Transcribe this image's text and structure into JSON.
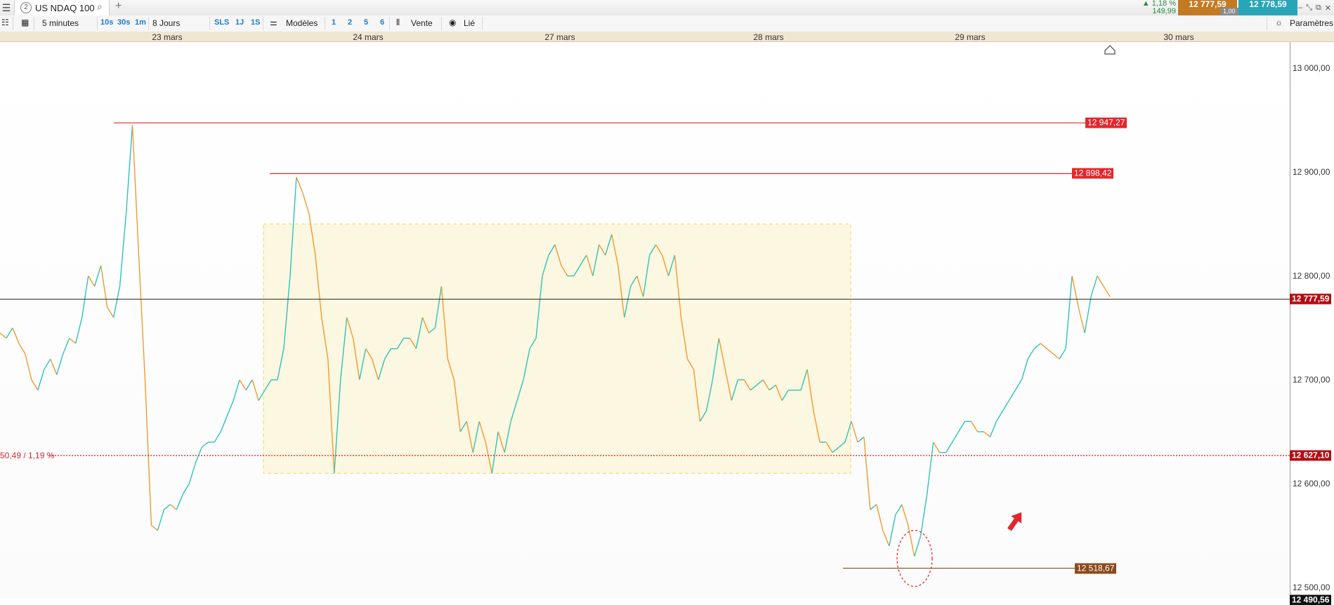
{
  "window": {
    "tab_number": "2",
    "tab_title": "US NDAQ 100",
    "add_tab_label": "+",
    "change_pct": "▲ 1,18 %",
    "change_abs": "149,99",
    "sell_price": "12 777,59",
    "buy_price": "12 778,59",
    "spread": "1,00",
    "settings_label": "Paramètres"
  },
  "toolbar": {
    "interval": "5 minutes",
    "quick_intervals": [
      "10s",
      "30s",
      "1m"
    ],
    "period": "8 Jours",
    "ranges": [
      "SLS",
      "1J",
      "1S"
    ],
    "templates_label": "Modèles",
    "template_slots": [
      "1",
      "2",
      "5",
      "6"
    ],
    "side_label": "Vente",
    "linked_label": "Lié"
  },
  "colors": {
    "up": "#2ec4b6",
    "down": "#f29a2e",
    "resistance": "#e3262c",
    "support": "#8b4a1c",
    "zone_fill": "#fbf6dc",
    "zone_border": "#f3d36a",
    "current_price_line": "#222222"
  },
  "chart_data": {
    "type": "line",
    "instrument": "US NDAQ 100",
    "timeframe": "5 minutes",
    "x_labels": [
      "23 mars",
      "24 mars",
      "27 mars",
      "28 mars",
      "29 mars",
      "30 mars"
    ],
    "ylim": [
      12490,
      13025
    ],
    "y_ticks": [
      "13 000,00",
      "12 900,00",
      "12 800,00",
      "12 700,00",
      "12 600,00",
      "12 500,00"
    ],
    "y_tick_values": [
      13000,
      12900,
      12800,
      12700,
      12600,
      12500
    ],
    "series": [
      {
        "values": [
          12745,
          12740,
          12750,
          12735,
          12725,
          12700,
          12690,
          12710,
          12720,
          12705,
          12725,
          12740,
          12735,
          12760,
          12800,
          12790,
          12810,
          12770,
          12760,
          12790,
          12860,
          12945,
          12820,
          12700,
          12560,
          12555,
          12575,
          12580,
          12575,
          12590,
          12600,
          12620,
          12635,
          12640,
          12640,
          12650,
          12665,
          12680,
          12700,
          12690,
          12700,
          12680,
          12690,
          12700,
          12700,
          12730,
          12800,
          12895,
          12880,
          12860,
          12820,
          12760,
          12720,
          12610,
          12700,
          12760,
          12740,
          12700,
          12730,
          12720,
          12700,
          12720,
          12730,
          12730,
          12740,
          12740,
          12730,
          12760,
          12745,
          12750,
          12790,
          12720,
          12700,
          12650,
          12660,
          12630,
          12660,
          12640,
          12610,
          12650,
          12630,
          12660,
          12680,
          12700,
          12730,
          12740,
          12800,
          12820,
          12830,
          12810,
          12800,
          12800,
          12810,
          12820,
          12800,
          12830,
          12820,
          12840,
          12810,
          12760,
          12790,
          12800,
          12780,
          12820,
          12830,
          12820,
          12800,
          12820,
          12760,
          12720,
          12710,
          12660,
          12670,
          12700,
          12740,
          12710,
          12680,
          12700,
          12700,
          12690,
          12695,
          12700,
          12690,
          12695,
          12680,
          12690,
          12690,
          12690,
          12710,
          12670,
          12640,
          12640,
          12630,
          12635,
          12640,
          12660,
          12640,
          12645,
          12575,
          12580,
          12555,
          12540,
          12570,
          12580,
          12560,
          12530,
          12550,
          12590,
          12640,
          12630,
          12630,
          12640,
          12650,
          12660,
          12660,
          12650,
          12650,
          12645,
          12660,
          12670,
          12680,
          12690,
          12700,
          12720,
          12730,
          12735,
          12730,
          12725,
          12720,
          12730,
          12800,
          12770,
          12745,
          12780,
          12800,
          12790,
          12780
        ]
      }
    ],
    "annotations": {
      "resistance_levels": [
        "12 947,27",
        "12 898,42"
      ],
      "support_level": "12 518,67",
      "current_price": "12 777,59",
      "previous_close": "12 627,10",
      "previous_close_label": "50,49 / 1,19 %",
      "range_zone": [
        12610,
        12850
      ],
      "bottom_label": "12 490,56"
    }
  }
}
